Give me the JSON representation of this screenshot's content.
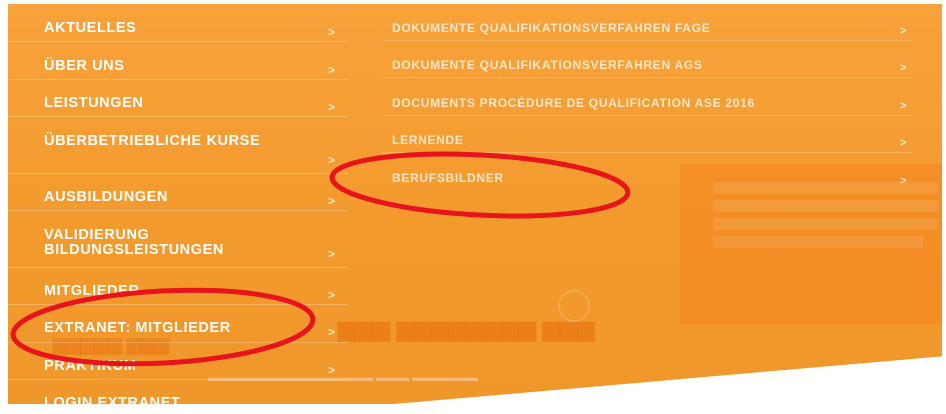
{
  "nav": {
    "items": [
      {
        "label": "AKTUELLES"
      },
      {
        "label": "ÜBER UNS"
      },
      {
        "label": "LEISTUNGEN"
      },
      {
        "label": "ÜBERBETRIEBLICHE KURSE"
      },
      {
        "label": "AUSBILDUNGEN"
      },
      {
        "label": "VALIDIERUNG BILDUNGSLEISTUNGEN"
      },
      {
        "label": "MITGLIEDER"
      },
      {
        "label": "EXTRANET: MITGLIEDER"
      },
      {
        "label": "PRAKTIKUM"
      },
      {
        "label": "LOGIN EXTRANET"
      }
    ],
    "chevron": ">"
  },
  "submenu": {
    "items": [
      {
        "label": "DOKUMENTE QUALIFIKATIONSVERFAHREN FAGE"
      },
      {
        "label": "DOKUMENTE QUALIFIKATIONSVERFAHREN AGS"
      },
      {
        "label": "DOCUMENTS PROCÉDURE DE QUALIFICATION ASE 2016"
      },
      {
        "label": "LERNENDE"
      },
      {
        "label": "BERUFSBILDNER"
      }
    ]
  },
  "colors": {
    "orange": "#f39a2d",
    "annotation_red": "#e8141b"
  }
}
